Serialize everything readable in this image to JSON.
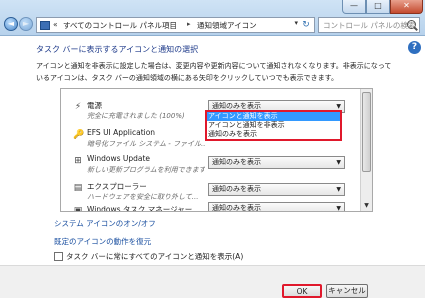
{
  "window": {
    "minimize_glyph": "—",
    "maximize_glyph": "□",
    "close_glyph": "✕"
  },
  "nav": {
    "back_glyph": "◄",
    "forward_glyph": "►"
  },
  "address": {
    "icon": "control-panel-icon",
    "breadcrumbs": [
      "«",
      "すべてのコントロール パネル項目",
      "通知領域アイコン"
    ],
    "separator": "▸"
  },
  "search": {
    "placeholder": "コントロール パネルの検索",
    "icon": "search-icon"
  },
  "help_glyph": "?",
  "heading": "タスク バーに表示するアイコンと通知の選択",
  "description": "アイコンと通知を非表示に設定した場合は、変更内容や更新内容について通知されなくなります。非表示になっているアイコンは、タスク バーの通知領域の横にある矢印をクリックしていつでも表示できます。",
  "list": {
    "rows": [
      {
        "icon": "power-icon",
        "name": "電源",
        "desc": "完全に充電されました (100%)",
        "value": "通知のみを表示"
      },
      {
        "icon": "efs-icon",
        "name": "EFS UI Application",
        "desc": "暗号化ファイル システム - ファイル...",
        "value": "アイコンと通知を表示"
      },
      {
        "icon": "windows-update-icon",
        "name": "Windows Update",
        "desc": "新しい更新プログラムを利用できます",
        "value": "通知のみを表示"
      },
      {
        "icon": "explorer-icon",
        "name": "エクスプローラー",
        "desc": "ハードウェアを安全に取り外して...",
        "value": "通知のみを表示"
      },
      {
        "icon": "task-manager-icon",
        "name": "Windows タスク マネージャー",
        "desc": "",
        "value": "通知のみを表示"
      }
    ],
    "dropdown_options": [
      "アイコンと通知を表示",
      "アイコンと通知を非表示",
      "通知のみを表示"
    ],
    "dropdown_selected_index": 0
  },
  "links": {
    "system_icons": "システム アイコンのオン/オフ",
    "restore_defaults": "既定のアイコンの動作を復元"
  },
  "checkbox": {
    "label": "タスク バーに常にすべてのアイコンと通知を表示(A)",
    "checked": false
  },
  "buttons": {
    "ok": "OK",
    "cancel": "キャンセル"
  },
  "colors": {
    "link": "#1a4fa0",
    "highlight": "#e0182b",
    "selection": "#3399ff"
  }
}
